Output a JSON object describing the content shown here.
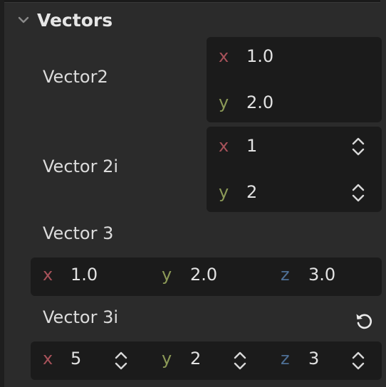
{
  "section": {
    "title": "Vectors",
    "icon": "chevron-down-icon"
  },
  "vector2": {
    "label": "Vector2",
    "x_label": "x",
    "x": "1.0",
    "y_label": "y",
    "y": "2.0"
  },
  "vector2i": {
    "label": "Vector 2i",
    "x_label": "x",
    "x": "1",
    "y_label": "y",
    "y": "2",
    "stepper_icon": "up-down-chevron-icon"
  },
  "vector3": {
    "label": "Vector 3",
    "x_label": "x",
    "x": "1.0",
    "y_label": "y",
    "y": "2.0",
    "z_label": "z",
    "z": "3.0"
  },
  "vector3i": {
    "label": "Vector 3i",
    "reset_icon": "reset-icon",
    "x_label": "x",
    "x": "5",
    "y_label": "y",
    "y": "2",
    "z_label": "z",
    "z": "3",
    "stepper_icon": "up-down-chevron-icon"
  },
  "colors": {
    "background": "#2b2b2b",
    "field": "#1b1b1b",
    "x_axis": "#a7525a",
    "y_axis": "#8c9a57",
    "z_axis": "#4e6f95"
  }
}
